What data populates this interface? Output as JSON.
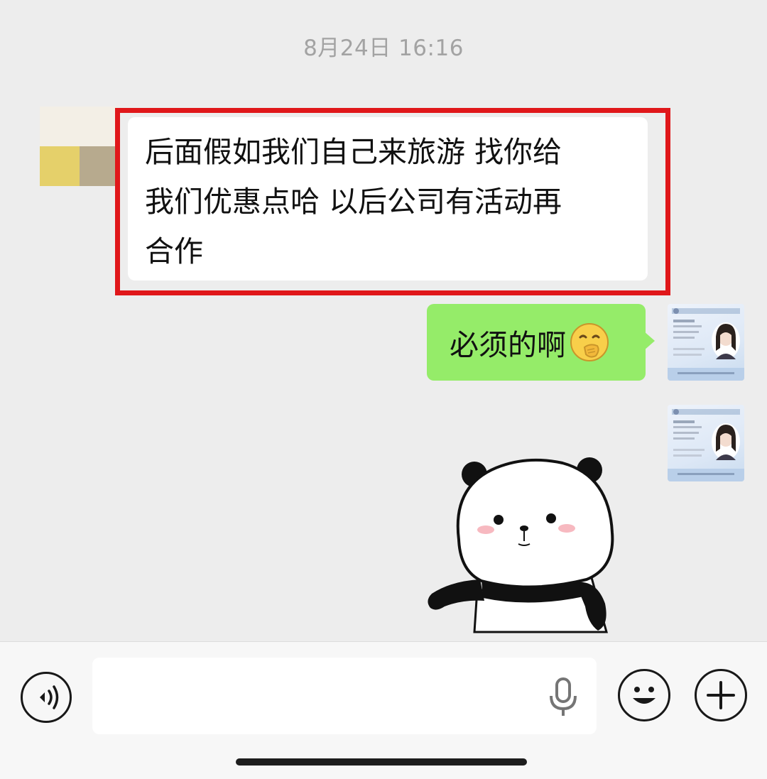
{
  "chat": {
    "timestamp": "8月24日 16:16",
    "messages": [
      {
        "direction": "received",
        "lines": [
          "后面假如我们自己来旅游 找你给",
          "我们优惠点哈 以后公司有活动再",
          "合作"
        ],
        "highlighted": true,
        "highlight_color": "#e0171a"
      },
      {
        "direction": "sent",
        "text": "必须的啊",
        "emoji": "hand-over-mouth-emoji",
        "bubble_color": "#95ec69"
      },
      {
        "direction": "sent",
        "type": "sticker",
        "sticker": "panda-sticker"
      }
    ]
  },
  "input_bar": {
    "placeholder": "",
    "icons": {
      "voice": "voice-toggle-icon",
      "mic": "microphone-icon",
      "emoji": "smiley-icon",
      "more": "plus-icon"
    }
  },
  "colors": {
    "background": "#ededed",
    "received_bubble": "#ffffff",
    "sent_bubble": "#95ec69",
    "timestamp_text": "#a3a3a3"
  }
}
